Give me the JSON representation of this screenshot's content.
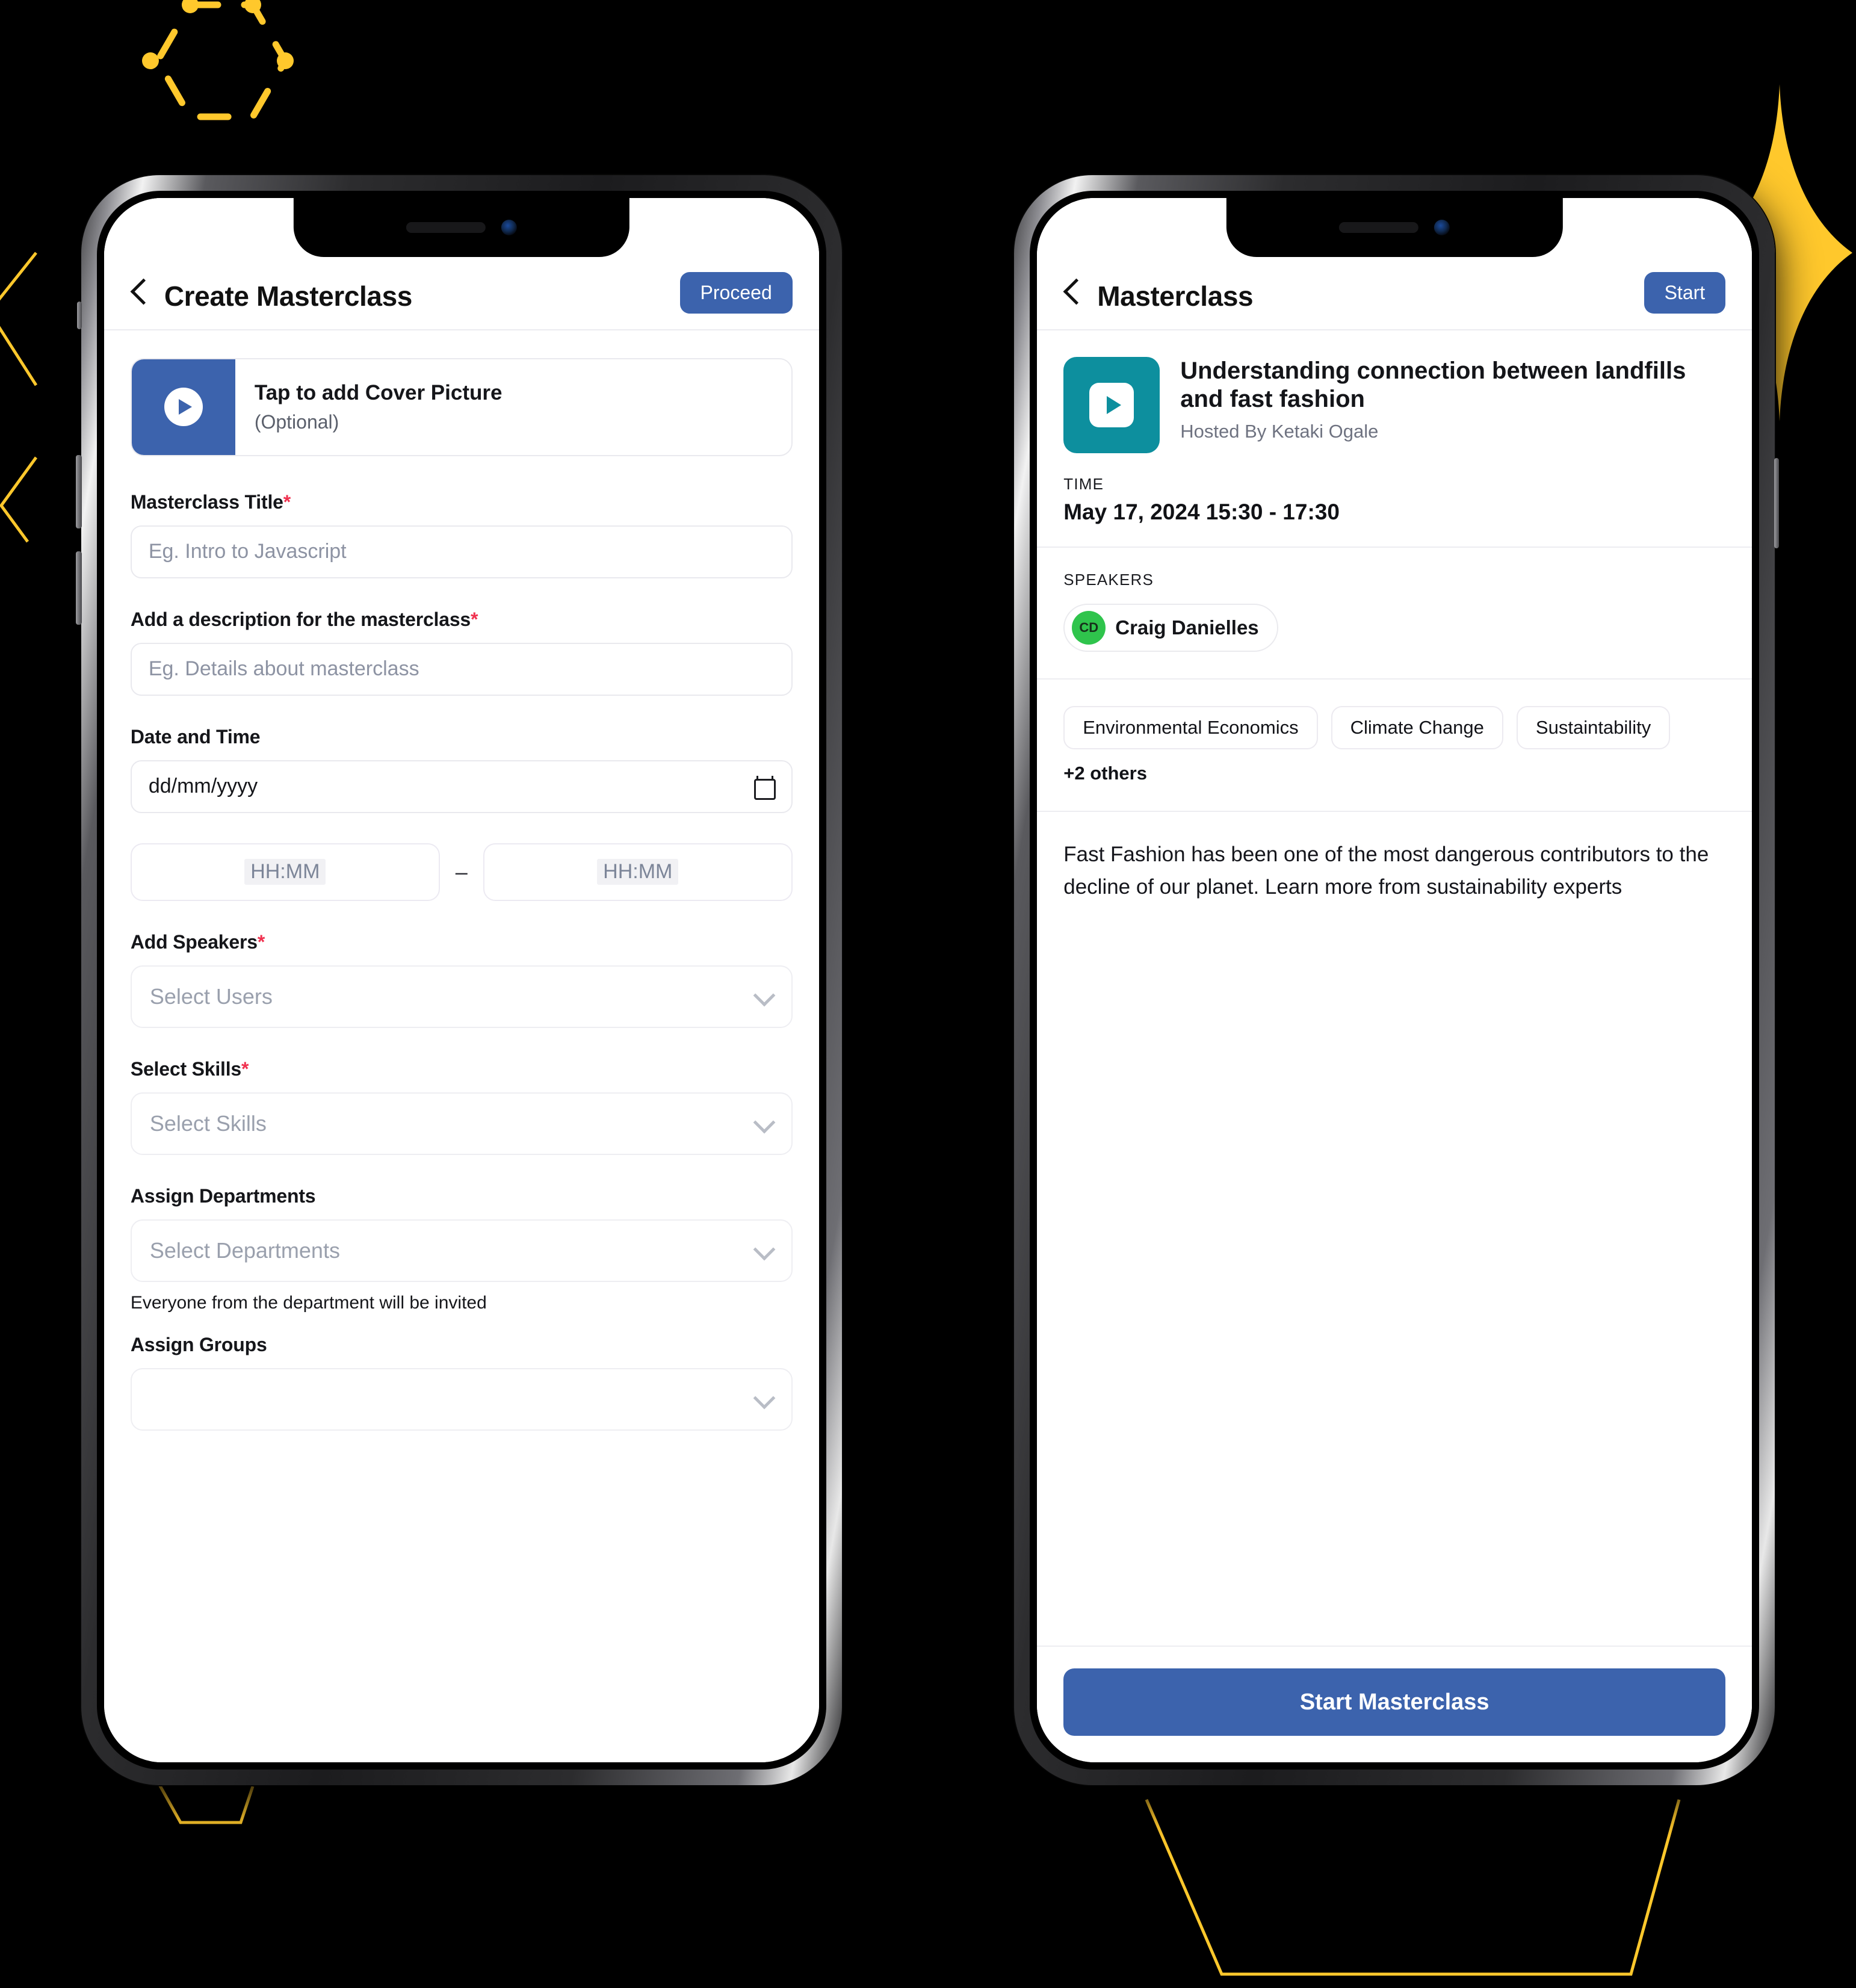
{
  "theme": {
    "accent_blue": "#3c63ad",
    "teal": "#0d8f9e",
    "green": "#2fc44c",
    "yellow": "#FFC82C",
    "required_red": "#f0314f",
    "background": "#000000"
  },
  "left_phone": {
    "appbar": {
      "back_icon": "chevron-left-icon",
      "title": "Create Masterclass",
      "action_label": "Proceed"
    },
    "cover": {
      "icon": "play-circle-icon",
      "title": "Tap to add Cover Picture",
      "subtitle": "(Optional)"
    },
    "fields": [
      {
        "label": "Masterclass Title",
        "required": true,
        "placeholder": "Eg. Intro to Javascript",
        "value": ""
      },
      {
        "label": "Add a description for the masterclass",
        "required": true,
        "placeholder": "Eg. Details about masterclass",
        "value": ""
      }
    ],
    "datetime": {
      "label": "Date and Time",
      "required": false,
      "date_placeholder": "dd/mm/yyyy",
      "date_value": "",
      "calendar_icon": "calendar-icon",
      "start_placeholder": "HH:MM",
      "start_value": "",
      "separator": "–",
      "end_placeholder": "HH:MM",
      "end_value": ""
    },
    "speakers": {
      "label": "Add Speakers",
      "required": true,
      "placeholder": "Select Users",
      "value": "",
      "chevron_icon": "chevron-down-icon"
    },
    "skills": {
      "label": "Select Skills",
      "required": true,
      "placeholder": "Select Skills",
      "value": "",
      "chevron_icon": "chevron-down-icon"
    },
    "departments": {
      "label": "Assign Departments",
      "required": false,
      "placeholder": "Select Departments",
      "value": "",
      "chevron_icon": "chevron-down-icon",
      "helper": "Everyone from the department will be invited"
    },
    "groups": {
      "label": "Assign Groups"
    }
  },
  "right_phone": {
    "appbar": {
      "back_icon": "chevron-left-icon",
      "title": "Masterclass",
      "action_label": "Start"
    },
    "detail": {
      "thumbnail_icon": "play-video-icon",
      "title": "Understanding connection between landfills and fast fashion",
      "host": "Hosted By Ketaki Ogale",
      "time_label": "TIME",
      "time_value": "May 17, 2024 15:30 - 17:30"
    },
    "speakers": {
      "label": "SPEAKERS",
      "list": [
        {
          "initials": "CD",
          "name": "Craig Danielles"
        }
      ]
    },
    "tags": {
      "items": [
        "Environmental Economics",
        "Climate Change",
        "Sustaintability"
      ],
      "more_label": "+2 others"
    },
    "description": "Fast Fashion has been one of the most dangerous contributors to the decline of our planet. Learn more from sustainability experts",
    "cta_label": "Start Masterclass"
  }
}
